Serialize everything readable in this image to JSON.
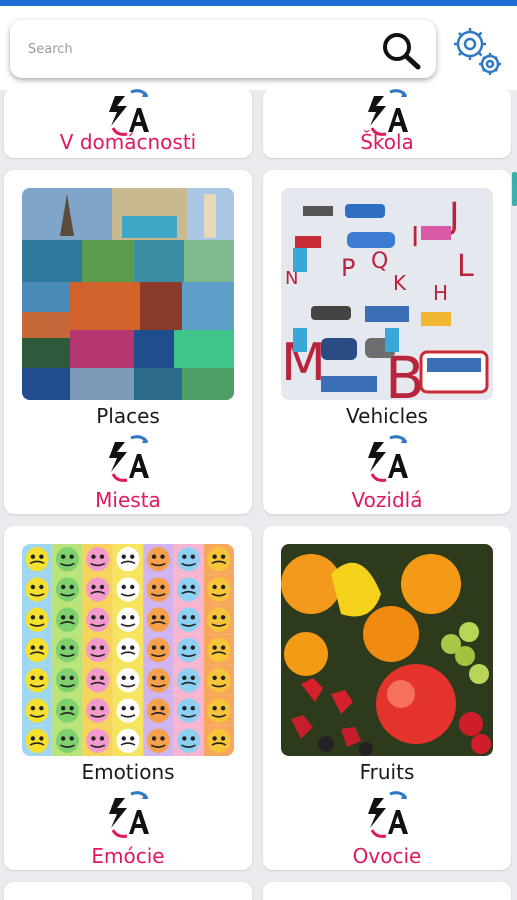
{
  "header": {
    "search_placeholder": "Search"
  },
  "cards": [
    {
      "name": "",
      "translation": "V domácnosti"
    },
    {
      "name": "",
      "translation": "Škola"
    },
    {
      "name": "Places",
      "translation": "Miesta"
    },
    {
      "name": "Vehicles",
      "translation": "Vozidlá"
    },
    {
      "name": "Emotions",
      "translation": "Emócie"
    },
    {
      "name": "Fruits",
      "translation": "Ovocie"
    }
  ],
  "colors": {
    "accent": "#e0185e",
    "status_bar": "#1f6fd6",
    "background": "#e9ebef",
    "icon_blue": "#2f78c4"
  },
  "icons": [
    "search-icon",
    "gear-icon",
    "translate-icon"
  ]
}
